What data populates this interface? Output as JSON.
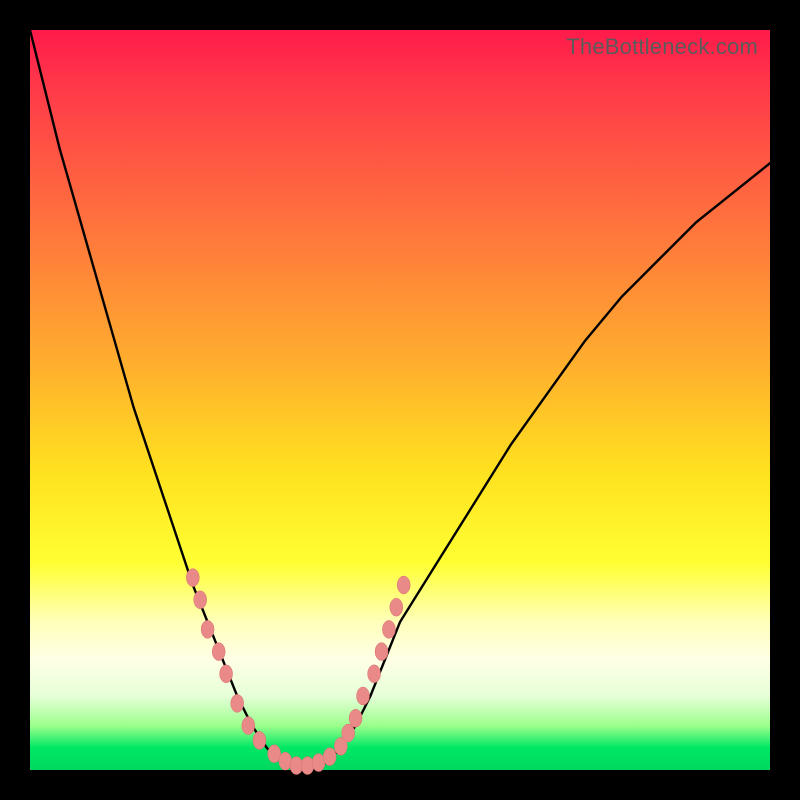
{
  "watermark": "TheBottleneck.com",
  "colors": {
    "frame": "#000000",
    "curve": "#000000",
    "marker_fill": "#e98a88",
    "marker_stroke": "#d87270",
    "y_band_highlight": "#ffffba"
  },
  "chart_data": {
    "type": "line",
    "title": "",
    "xlabel": "",
    "ylabel": "",
    "xlim": [
      0,
      100
    ],
    "ylim": [
      0,
      100
    ],
    "x": [
      0,
      2,
      4,
      6,
      8,
      10,
      12,
      14,
      16,
      18,
      20,
      22,
      24,
      26,
      28,
      30,
      32,
      34,
      36,
      38,
      40,
      42,
      44,
      46,
      48,
      50,
      55,
      60,
      65,
      70,
      75,
      80,
      85,
      90,
      95,
      100
    ],
    "values": [
      100,
      92,
      84,
      77,
      70,
      63,
      56,
      49,
      43,
      37,
      31,
      25,
      20,
      15,
      10,
      6,
      3,
      1,
      0,
      0,
      1,
      3,
      6,
      10,
      15,
      20,
      28,
      36,
      44,
      51,
      58,
      64,
      69,
      74,
      78,
      82
    ],
    "series": [
      {
        "name": "left-branch",
        "x": [
          0,
          2,
          4,
          6,
          8,
          10,
          12,
          14,
          16,
          18,
          20,
          22,
          24,
          26,
          28,
          30,
          32,
          34,
          36
        ],
        "values": [
          100,
          92,
          84,
          77,
          70,
          63,
          56,
          49,
          43,
          37,
          31,
          25,
          20,
          15,
          10,
          6,
          3,
          1,
          0
        ]
      },
      {
        "name": "right-branch",
        "x": [
          36,
          38,
          40,
          42,
          44,
          46,
          48,
          50,
          55,
          60,
          65,
          70,
          75,
          80,
          85,
          90,
          95,
          100
        ],
        "values": [
          0,
          0,
          1,
          3,
          6,
          10,
          15,
          20,
          28,
          36,
          44,
          51,
          58,
          64,
          69,
          74,
          78,
          82
        ]
      }
    ],
    "markers": {
      "note": "pink bead markers overlaid near the trough on both branches, approximate positions",
      "points": [
        {
          "x": 22,
          "y": 26
        },
        {
          "x": 23,
          "y": 23
        },
        {
          "x": 24,
          "y": 19
        },
        {
          "x": 25.5,
          "y": 16
        },
        {
          "x": 26.5,
          "y": 13
        },
        {
          "x": 28,
          "y": 9
        },
        {
          "x": 29.5,
          "y": 6
        },
        {
          "x": 31,
          "y": 4
        },
        {
          "x": 33,
          "y": 2.2
        },
        {
          "x": 34.5,
          "y": 1.2
        },
        {
          "x": 36,
          "y": 0.6
        },
        {
          "x": 37.5,
          "y": 0.6
        },
        {
          "x": 39,
          "y": 1
        },
        {
          "x": 40.5,
          "y": 1.8
        },
        {
          "x": 42,
          "y": 3.2
        },
        {
          "x": 43,
          "y": 5
        },
        {
          "x": 44,
          "y": 7
        },
        {
          "x": 45,
          "y": 10
        },
        {
          "x": 46.5,
          "y": 13
        },
        {
          "x": 47.5,
          "y": 16
        },
        {
          "x": 48.5,
          "y": 19
        },
        {
          "x": 49.5,
          "y": 22
        },
        {
          "x": 50.5,
          "y": 25
        }
      ]
    }
  }
}
